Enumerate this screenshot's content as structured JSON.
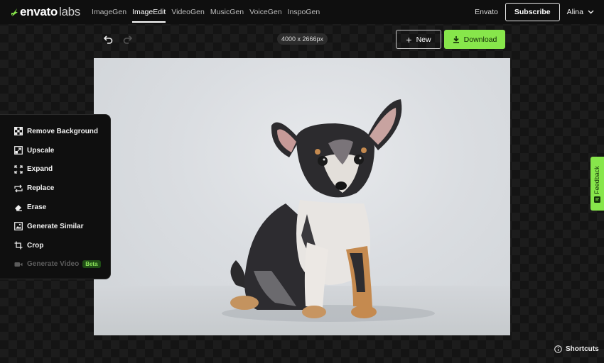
{
  "brand": {
    "name": "envato",
    "suffix": "labs",
    "accent": "#87e64b"
  },
  "nav": {
    "items": [
      {
        "label": "ImageGen"
      },
      {
        "label": "ImageEdit"
      },
      {
        "label": "VideoGen"
      },
      {
        "label": "MusicGen"
      },
      {
        "label": "VoiceGen"
      },
      {
        "label": "InspoGen"
      }
    ],
    "active": "ImageEdit"
  },
  "header": {
    "envato_link": "Envato",
    "subscribe_label": "Subscribe",
    "user_name": "Alina"
  },
  "toolbar": {
    "image_dimensions": "4000 x 2666px",
    "new_label": "New",
    "download_label": "Download",
    "undo_icon": "undo-icon",
    "redo_icon": "redo-icon"
  },
  "tools": [
    {
      "label": "Remove Background",
      "icon": "checkerboard-icon",
      "enabled": true
    },
    {
      "label": "Upscale",
      "icon": "upscale-icon",
      "enabled": true
    },
    {
      "label": "Expand",
      "icon": "expand-icon",
      "enabled": true
    },
    {
      "label": "Replace",
      "icon": "replace-icon",
      "enabled": true
    },
    {
      "label": "Erase",
      "icon": "eraser-icon",
      "enabled": true
    },
    {
      "label": "Generate Similar",
      "icon": "image-icon",
      "enabled": true
    },
    {
      "label": "Crop",
      "icon": "crop-icon",
      "enabled": true
    },
    {
      "label": "Generate Video",
      "icon": "video-icon",
      "enabled": false,
      "badge": "Beta"
    }
  ],
  "feedback": {
    "label": "Feedback"
  },
  "shortcuts": {
    "label": "Shortcuts"
  }
}
